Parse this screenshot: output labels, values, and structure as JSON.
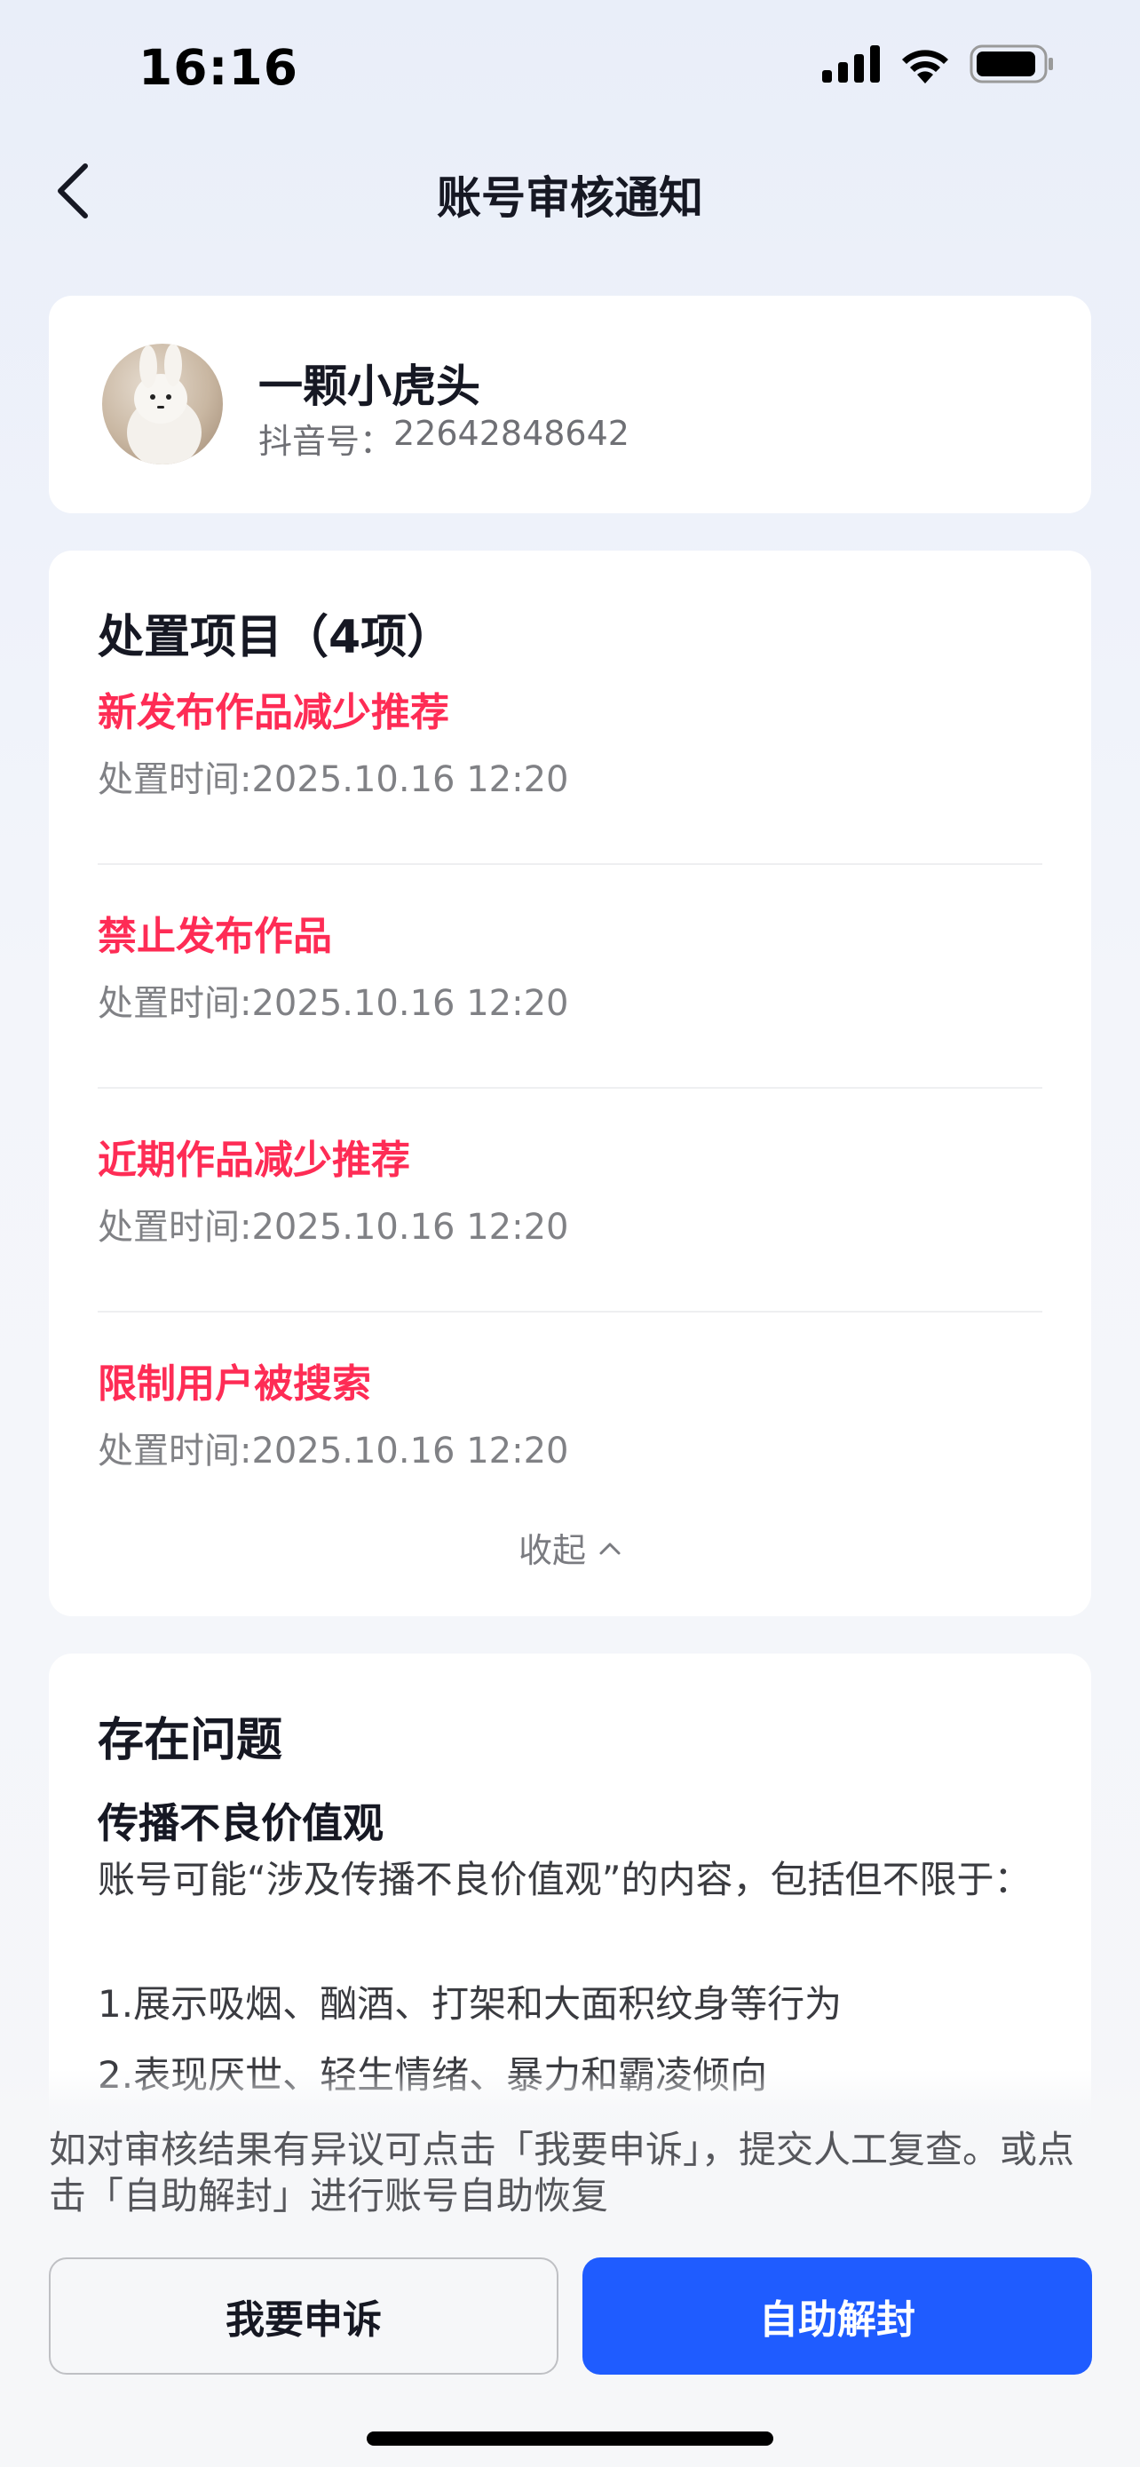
{
  "status_bar": {
    "time": "16:16",
    "icons": [
      "signal-icon",
      "wifi-icon",
      "battery-icon"
    ]
  },
  "nav": {
    "back_icon": "chevron-left-icon",
    "title": "账号审核通知"
  },
  "profile": {
    "name": "一颗小虎头",
    "id_label": "抖音号：",
    "id_value": "22642848642"
  },
  "actions": {
    "title": "处置项目（4项）",
    "items": [
      {
        "name": "新发布作品减少推荐",
        "time": "处置时间:2025.10.16 12:20"
      },
      {
        "name": "禁止发布作品",
        "time": "处置时间:2025.10.16 12:20"
      },
      {
        "name": "近期作品减少推荐",
        "time": "处置时间:2025.10.16 12:20"
      },
      {
        "name": "限制用户被搜索",
        "time": "处置时间:2025.10.16 12:20"
      }
    ],
    "collapse_label": "收起"
  },
  "issue": {
    "title": "存在问题",
    "subtitle": "传播不良价值观",
    "description": "账号可能“涉及传播不良价值观”的内容，包括但不限于：",
    "lines": [
      "1.展示吸烟、酗酒、打架和大面积纹身等行为",
      "2.表现厌世、轻生情绪、暴力和霸凌倾向"
    ]
  },
  "bottom": {
    "note": "如对审核结果有异议可点击「我要申诉」，提交人工复查。或点击「自助解封」进行账号自助恢复",
    "appeal_label": "我要申诉",
    "unblock_label": "自助解封"
  },
  "colors": {
    "accent_red": "#fe2c55",
    "primary_blue": "#1f5cff"
  }
}
